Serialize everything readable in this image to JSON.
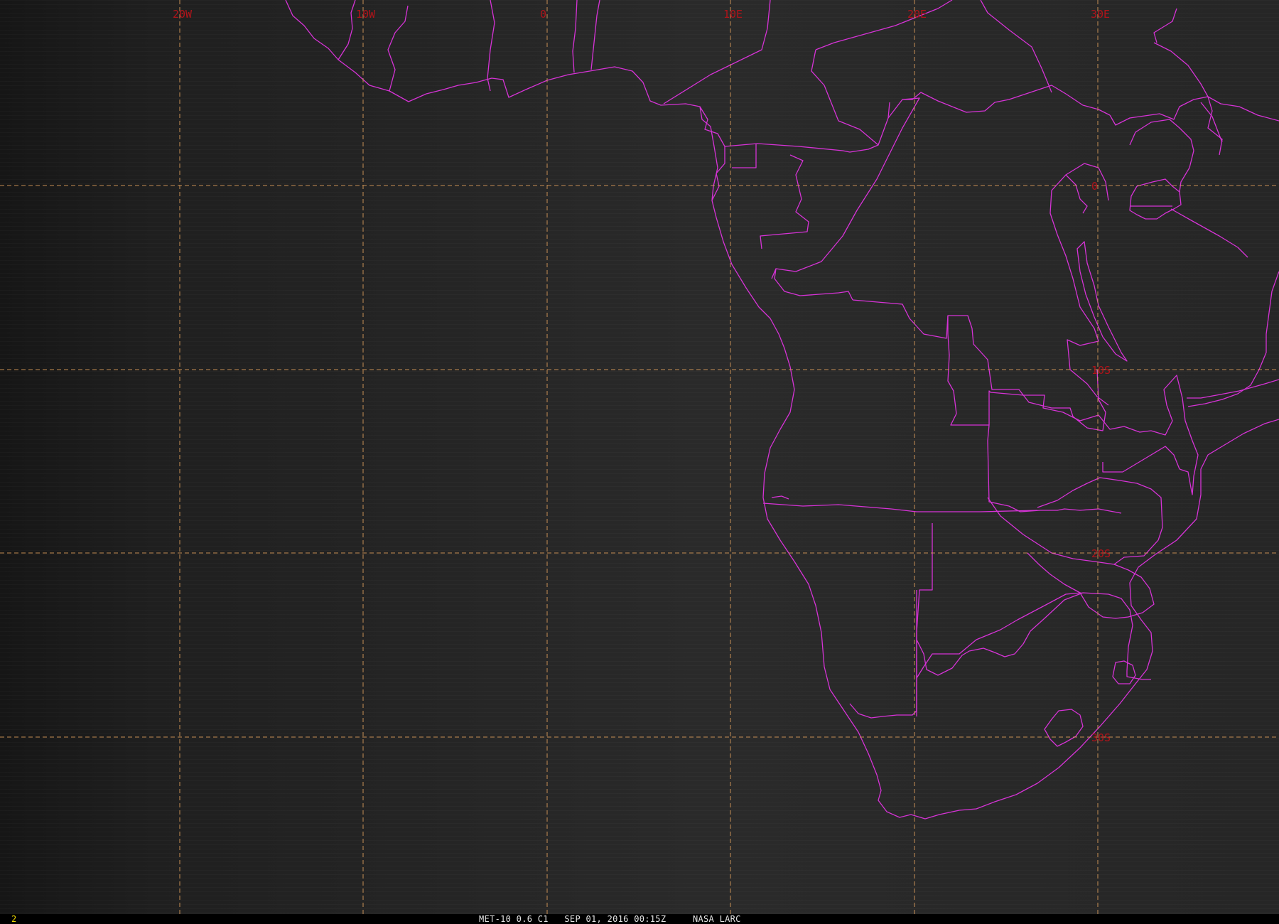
{
  "viewer": {
    "frame_number": "2",
    "caption": "MET-10 0.6 C1   SEP 01, 2016 00:15Z     NASA LARC"
  },
  "grid": {
    "longitude_labels": [
      "20W",
      "10W",
      "0",
      "10E",
      "20E",
      "30E"
    ],
    "latitude_labels": [
      "0",
      "10S",
      "20S",
      "30S"
    ]
  },
  "colors": {
    "background": "#1a1a1a",
    "borders": "#d633d6",
    "grid": "#d99b5a",
    "grid_labels": "#b0141a",
    "frame_number": "#e8d400",
    "caption": "#e6e6e6"
  }
}
